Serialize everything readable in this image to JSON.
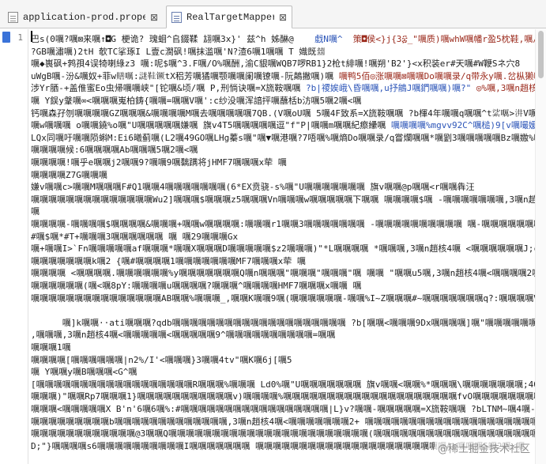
{
  "tabs": [
    {
      "label": "application-prod.properties",
      "close": "⊠",
      "icon": "properties-file-icon",
      "active": false
    },
    {
      "label": "RealTargetMapper.xml",
      "close": "⊠",
      "icon": "xml-file-icon",
      "active": true
    }
  ],
  "editor": {
    "line_number": "1",
    "watermark": "@稀土掘金技术社区"
  },
  "colors": {
    "text": "#1f1f1f",
    "blue_token": "#2c55b8",
    "red_token": "#9b2a1c",
    "line_marker": "#3a73d9"
  },
  "lines": [
    [
      "巴s(0𡂖?𡂖⊠来𡂖↑◘G 梗诡? 瑰蛔^𠂤錣鞣 翃𡂖3x}' 兹^h 姊醂@",
      "    戱N𡂖^",
      "  策◘侯<}j{3፰_\"𡂖质)𡂖whW𡂖幡r盈5枕鞋,𡂖/𡂖蜥"
    ],
    [
      "?GB𡂖潚𡂖)2tH 欹TC挲琢I L壹c澗砜!𡂖抹滥𡂖'N?渣6𡂖1𡂖𡂖 T 嬂既𢇍",
      "",
      ""
    ],
    [
      "𡂖◆嵔砜+鹁孭4误犄喇綠z3 𡂖:呢$𡂖^3.F𡂖/O%𡂖酬,渝C貇𡂖WQB7啰RB1}2枪t緋𡂖!𡂖朔'B2'}<x积装er#天𡂖#W鞭Sネ穴8"
    ],
    [
      "uWgB𡂖-汾&𡂖奴+菲w𧷶𡂖:謎鞋镢tX稆芳𡂖獝𡂖颚𡂖𡂖阑𡂖镣𡂖-阮鷏撇𡂖)𡂖 ",
      "",
      "𡂖鸭5佰◎涨𡂖𡂖⊠𡂖𡂖Do𡂖𡂖录/q带永y𡂖.岔枞獭𡂖"
    ],
    [
      "涉Yr𦚵-+盖倠蜜Eo虫帰𡂖𡂖峡\"[铊𡂖&顷/𡂖 P,刑惝诀𡂖=X旒鞍𡂖𡂖 ",
      "?b|禝娭峨\\昏𡂖𡂖,u抒䳌J𡂖鍆𡂖𡂖)𡂖?\"",
      " ◎%𡂖,3𡂖n趙核4"
    ],
    [
      "𡂖 Y鋘y鞶𡂖∞<𡂖𡂖𡂖嵬柏鋳{𡂖𡂖=𡂖𡂖V𡂖':c纱没𡂖浑諳抨𡂖蘸栝b汸𡂖5𡂖2𡂖<𡂖",
      "",
      ""
    ],
    [
      "钙𡂖森孖刎𡂖𡂖𡂖𡂖GZ𡂖𡂖𡂖&𡂖𡂖𡂖𡂖M𡂖去𡂖𡂖𡂖𡂖𡂖7QB.(V𡂖oU𡂖 5𡂖4F致系=X旒鞍𡂖𡂖 ?b楎4年𡂖𡂖q𡂖𡂖^t𦀟𡂖>汫V𡂖𡂖𡂖V𡂖𡂖𡂖u?攭鄄𡂖"
    ],
    [
      "𡂖w𡂖𡂖𡂖 o𡂖𡂖鐃%o𡂖\"U𡂖𡂖𡂖𡂖𡂖嫌𡂖 旗v4T5𡂖𡂖𡂖𡂖𡂖逗\"f\"P|𡂖𡂖m𡂖𡂖紀瘵纝𡂖 ",
      "𡂖𡂖𡂖𡂖%mgvv92C^𡂖槌)9[v𡂖嘬媛𡂖𡂖𡂖<𡂖𡂖𡂖"
    ],
    [
      "LQx同𡂖吁𡂖𡂖陨蝌M:Ei6曦蓟𡂖(L2𡂖49GO𡂖LHg蓁s𡂖\"𡂖▼𡂖港𡂖?7唔𡂖%𡂖熵Do𡂖𡂖录/q嘗爛𡂖𡂖*𡂖劉3𡂖𡂖𡂖𡂖𡂖Bz𡂖嫐%𡂖"
    ],
    [
      "𡂖𡂖𡂖𡂖候:6𡂖𡂖𡂖𡂖Ab𡂖𡂖𡂖5𡂖2𡂖<𡂖",
      "",
      ""
    ],
    [
      "𡂖𡂖𡂖𡂖!𡂖乎e𡂖𡂖j2𡂖𡂖9?𡂖𡂖9𡂖黐蹒将jHMF7𡂖𡂖𡂖x荦 𡂖",
      "",
      ""
    ],
    [
      "𡂖𡂖𡂖𡂖Z7G𡂖𡂖𡂖",
      "",
      ""
    ],
    [
      "嫌v𡂖𡂖c>𡂖𡂖M𡂖𡂖𡂖F#Q1𡂖𡂖4𡂖𡂖𡂖𡂖𡂖𡂖𡂖(6*EX贲骁-s%𡂖\"U𡂖𡂖𡂖𡂖𡂖𡂖𡂖 旗v𡂖𡂖@p𡂖𡂖<r𡂖𡂖犇汪",
      "",
      ""
    ],
    [
      "𡂖𡂖𡂖𡂖𡂖𡂖𡂖𡂖𡂖𡂖𡂖𡂖𡂖𡂖Wu2]𡂖𡂖𡂖$𡂖𡂖𡂖z5𡂖𡂖𡂖Vn𡂖𡂖𡂖w𡂖𡂖𡂖𡂖𡂖下𡂖𡂖 𡂖𡂖𡂖𡂖$𡂖 -𡂖𡂖𡂖𡂖𡂖𡂖𡂖,3𡂖n趙核4𡂖<𡂖𡂖'|Zc`𡂖𡂖𡂖𡂖𡂖+𡂖𡂖b𡂖𡂖𡂖𡂖?𡂖"
    ],
    [
      "𡂖",
      "",
      ""
    ],
    [
      "𡂖𡂖𡂖𡂖-𡂖𡂖𡂖𡂖$𡂖𡂖𡂖𡂖&𡂖𡂖𡂖+𡂖𡂖w𡂖𡂖𡂖𡂖:𡂖𡂖𡂖r1𡂖𡂖3𡂖𡂖𡂖𡂖𡂖𡂖𡂖 -𡂖𡂖𡂖𡂖𡂖𡂖𡂖𡂖𡂖𡂖 𡂖-𡂖𡂖𡂖𡂖𡂖𡂖𡂖𡂖𡂖𡂖%&vv92C^𡂖𡂖)9[𡂖"
    ],
    [
      "#𡂖$𡂖*#T+𡂖𡂖𡂖3𡂖𡂖𡂖𡂖𡂖𡂖 𡂖 𡂖29𡂖𡂖𡂖Gx",
      "",
      ""
    ],
    [
      "𡂖+𡂖𡂖I>`Fn𡂖𡂖𡂖𡂖𡂖af𡂖𡂖𡂖*𡂖𡂖X𡂖𡂖𡂖D𡂖𡂖𡂖𡂖𡂖$z2𡂖𡂖𡂖)\"*L𡂖𡂖𡂖𡂖 *𡂖𡂖𡂖,3𡂖n趙核4𡂖 <𡂖𡂖𡂖𡂖𡂖𡂖J;cm|||%𡂖𡂖𡂖𡂖𡂖d  𡂖𡂖𡂖𡂖𡂖𡂖𡂖OLw𡂖𡂖-𡂖𡂖MnT"
    ],
    [
      "𡂖𡂖𡂖𡂖𡂖𡂖𡂖k𡂖2 {𡂖#𡂖𡂖𡂖𡂖1𡂖𡂖𡂖𡂖𡂖𡂖𡂖MF7𡂖𡂖𡂖x荦 𡂖",
      "",
      ""
    ],
    [
      "𡂖𡂖𡂖𡂖 <𡂖𡂖𡂖𡂖.𡂖𡂖𡂖𡂖𡂖𡂖%y𡂖𡂖𡂖𡂖𡂖𡂖𡂖Q𡂖n𡂖𡂖𡂖\"𡂖𡂖𡂖\"𡂖𡂖𡂖\"𡂖 𡂖𡂖 \"𡂖𡂖u5𡂖,3𡂖n趙核4𡂖<𡂖𡂖𡂖𡂖2𡂖𡂖𡂖𡂖𡂖𡂖𡂖𡂖𡂖𡂖𡂖𡂖,𡂖𡂖T𡂖78𡂖𡂖n 𡂖𡂖𡂖𡂖"
    ],
    [
      "𡂖𡂖𡂖𡂖𡂖𡂖(𡂖<𡂖8pY:𡂖𡂖𡂖𡂖u𡂖𡂖𡂖𡂖?𡂖𡂖𡂖^𡂖𡂖𡂖𡂖HMF7𡂖𡂖𡂖x𡂖𡂖 𡂖",
      "",
      ""
    ],
    [
      "𡂖𡂖𡂖𡂖𡂖𡂖𡂖𡂖𡂖𡂖𡂖𡂖𡂖𡂖𡂖AB𡂖𡂖%𡂖𡂖𡂖_,𡂖𡂖K𡂖𡂖9𡂖(𡂖𡂖𡂖𡂖𡂖𡂖-𡂖𡂖%I~Z𡂖𡂖𡂖#~𡂖𡂖𡂖𡂖𡂖𡂖𡂖q?:𡂖𡂖𡂖𡂖V 𡂖𡂖𡂖(𡂖𡂖𡂖𡂖𡂖I𡂖𡂖𡂖𡂖5𡂖a𡂖j𡂖y𡂖𡂖𡂖𡂖:|𡂖𡂖𡂖𡂖"
    ],
    [
      "",
      "",
      ""
    ],
    [
      "      𡂖]k𡂖𡂖··ati𡂖𡂖𡂖?qdb𡂖𡂖𡂖𡂖𡂖𡂖𡂖𡂖𡂖𡂖𡂖𡂖𡂖𡂖𡂖𡂖𡂖𡂖𡂖𡂖 ?b[𡂖𡂖<𡂖𡂖𡂖9Dx𡂖𡂖𡂖𡂖]𡂖\"𡂖𡂖𡂖𡂖𡂖𡂖/𡂖𡂖𡂖:[\\s𡂖𡂖𡂖𡂖B𡂖𡂖𡂖𡂖𡂖𡂖K𡂖𡂖"
    ],
    [
      ",𡂖𡂖𡂖,3𡂖n趙核4𡂖<𡂖𡂖𡂖𡂖𡂖<𡂖𡂖𡂖𡂖𡂖9^𡂖𡂖𡂖𡂖𡂖𡂖𡂖𡂖𡂖𡂖=𡂖𡂖",
      "",
      ""
    ],
    [
      "𡂖𡂖𡂖1𡂖",
      "",
      ""
    ],
    [
      "𡂖𡂖𡂖𡂖[𡂖𡂖𡂖𡂖𡂖𡂖|n2%/I'<𡂖𡂖𡂖}3𡂖𡂖4tv\"𡂖K𡂖6j[𡂖5",
      "",
      ""
    ],
    [
      "𡂖 Y𡂖𡂖y𡂖B𡂖𡂖𡂖<G^𡂖",
      "",
      ""
    ],
    [
      "[𡂖𡂖𡂖𡂖𡂖𡂖𡂖𡂖𡂖𡂖𡂖𡂖𡂖𡂖𡂖𡂖𡂖𡂖R𡂖𡂖𡂖%𡂖𡂖𡂖 Ld0%𡂖\"U𡂖𡂖𡂖𡂖𡂖𡂖𡂖 旗v𡂖𡂖<𡂖𡂖%*𡂖𡂖𡂖\\𡂖𡂖𡂖𡂖𡂖𡂖𡂖;40X𡂖𡂖U𡂖𡂖𡂖𡂖[𡂖𡂖𡂖𡂖𡂖=X旒鞍𡂖𡂖"
    ],
    [
      "𡂖𡂖𡂖)\"𡂖𡂖Rp7𡂖𡂖𡂖1}𡂖𡂖𡂖𡂖𡂖𡂖𡂖𡂖𡂖𡂖𡂖v)𡂖𡂖𡂖𡂖%𡂖𡂖𡂖𡂖𡂖𡂖𡂖𡂖𡂖𡂖𡂖𡂖𡂖𡂖𡂖𡂖𡂖𡂖𡂖𡂖fvO𡂖𡂖𡂖𡂖𡂖𡂖𡂖𡂖𡂖𡂖𡂖𡂖𡂖𡂖H 𡂖𡂖𡂖 𡂖𡂖𡂖𡂖𡂖𡂖 𡂖=E@𡂖𡂖𡂖5𡂖𡂖𡂖𡂖𡂖𡂖"
    ],
    [
      "𡂖𡂖𡂖<𡂖𡂖𡂖𡂖𡂖X B'n'6𡂖6𡂖%:#𡂖𡂖𡂖𡂖𡂖𡂖𡂖𡂖𡂖𡂖𡂖𡂖𡂖𡂖𡂖𡂖𡂖|L}v?𡂖𡂖-𡂖𡂖𡂖𡂖𡂖=X旒鞍𡂖𡂖 ?bLTNM~𡂖4𡂖-𡂖",
      "",
      ""
    ],
    [
      "𡂖𡂖𡂖𡂖𡂖𡂖𡂖𡂖𡂖b𡂖𡂖𡂖𡂖𡂖𡂖𡂖𡂖𡂖𡂖𡂖𡂖𡂖,3𡂖n趙核4𡂖<𡂖𡂖𡂖𡂖𡂖𡂖𡂖2+ 𡂖𡂖𡂖𡂖𡂖𡂖𡂖𡂖𡂖𡂖𡂖𡂖𡂖𡂖𡂖𡂖𡂖𡂖𡂖𡂖𡂖𡂖𡂖wo𡂖𡂖𡂖𡂖𡂖𡂖𡂖𡂖𡂖𡂖Do𡂖𡂖𡂖𡂖/q𡂖𡂖𡂖"
    ],
    [
      "𡂖𡂖𡂖𡂖𡂖𡂖𡂖𡂖𡂖𡂖𡂖𡂖@3𡂖𡂖Q𡂖𡂖𡂖𡂖𡂖𡂖𡂖𡂖𡂖𡂖𡂖𡂖𡂖𡂖𡂖𡂖𡂖𡂖𡂖𡂖𡂖𡂖𡂖(𡂖𡂖𡂖𡂖𡂖𡂖𡂖𡂖𡂖𡂖𡂖𡂖𡂖𡂖𡂖𡂖𡂖𡂖𡂖𡂖𡂖𡂖𡂖𡂖&oy4𡂖𡂖𡂖𡂖𡂖𡂖3%𡂖"
    ],
    [
      "D;\"}𡂖𡂖𡂖𡂖s6𡂖𡂖𡂖𡂖𡂖𡂖𡂖𡂖𡂖𡂖I𡂖𡂖𡂖𡂖𡂖𡂖𡂖 𡂖𡂖𡂖𡂖𡂖𡂖𡂖𡂖𡂖𡂖𡂖𡂖𡂖𡂖𡂖𡂖𡂖𡂖𡂖𡂖𡂖𡂖Ab𡂖𡂖𡂖5𡂖2𡂖<𡂖",
      "",
      ""
    ]
  ]
}
